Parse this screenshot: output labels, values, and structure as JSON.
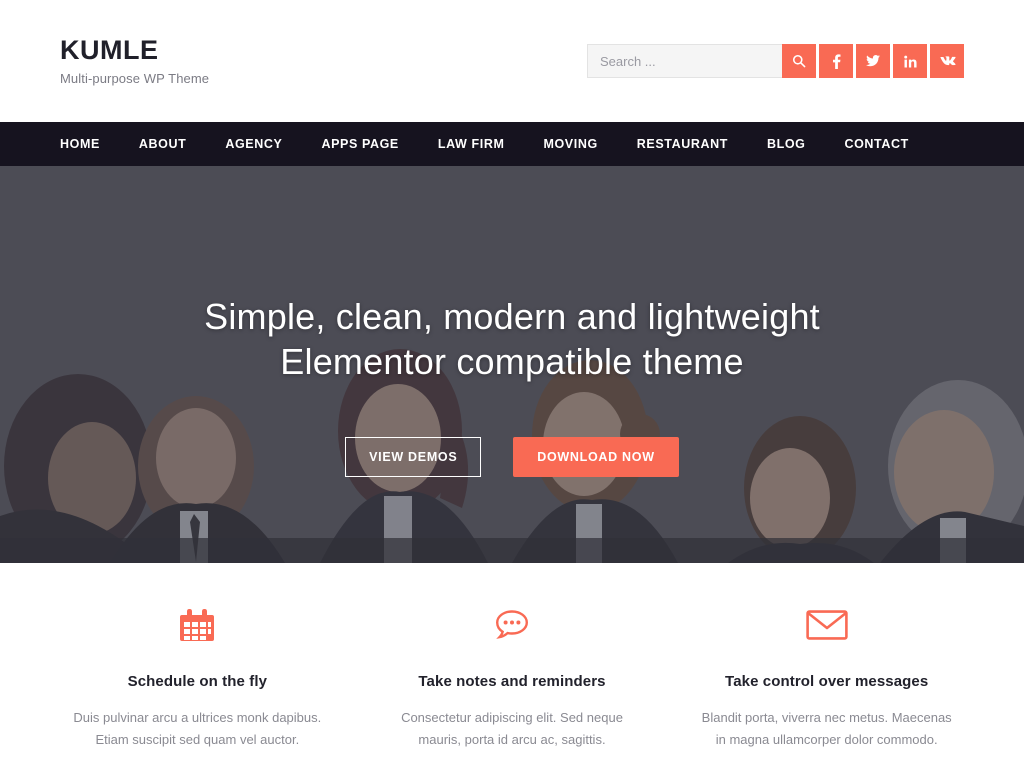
{
  "header": {
    "brand_title": "KUMLE",
    "brand_subtitle": "Multi-purpose WP Theme",
    "search": {
      "placeholder": "Search ...",
      "value": "",
      "search_icon": "search-icon"
    },
    "social": [
      {
        "name": "facebook",
        "label": "f",
        "icon": "facebook-icon"
      },
      {
        "name": "twitter",
        "label": "",
        "icon": "twitter-icon"
      },
      {
        "name": "linkedin",
        "label": "in",
        "icon": "linkedin-icon"
      },
      {
        "name": "vk",
        "label": "vk",
        "icon": "vk-icon"
      }
    ],
    "accent_color": "#f96a54"
  },
  "nav": {
    "background_color": "#16131f",
    "items": [
      {
        "label": "HOME"
      },
      {
        "label": "ABOUT"
      },
      {
        "label": "AGENCY"
      },
      {
        "label": "APPS PAGE"
      },
      {
        "label": "LAW FIRM"
      },
      {
        "label": "MOVING"
      },
      {
        "label": "RESTAURANT"
      },
      {
        "label": "BLOG"
      },
      {
        "label": "CONTACT"
      }
    ]
  },
  "hero": {
    "title_line1": "Simple, clean, modern and lightweight",
    "title_line2": "Elementor compatible theme",
    "primary_button": "DOWNLOAD NOW",
    "secondary_button": "VIEW DEMOS",
    "overlay_color": "#46464e"
  },
  "features": [
    {
      "icon": "calendar-icon",
      "title": "Schedule on the fly",
      "description": "Duis pulvinar arcu a ultrices monk dapibus. Etiam suscipit sed quam vel auctor."
    },
    {
      "icon": "chat-bubble-icon",
      "title": "Take notes and reminders",
      "description": "Consectetur adipiscing elit. Sed neque mauris, porta id arcu ac, sagittis."
    },
    {
      "icon": "envelope-icon",
      "title": "Take control over messages",
      "description": "Blandit porta, viverra nec metus. Maecenas in magna ullamcorper dolor commodo."
    }
  ]
}
